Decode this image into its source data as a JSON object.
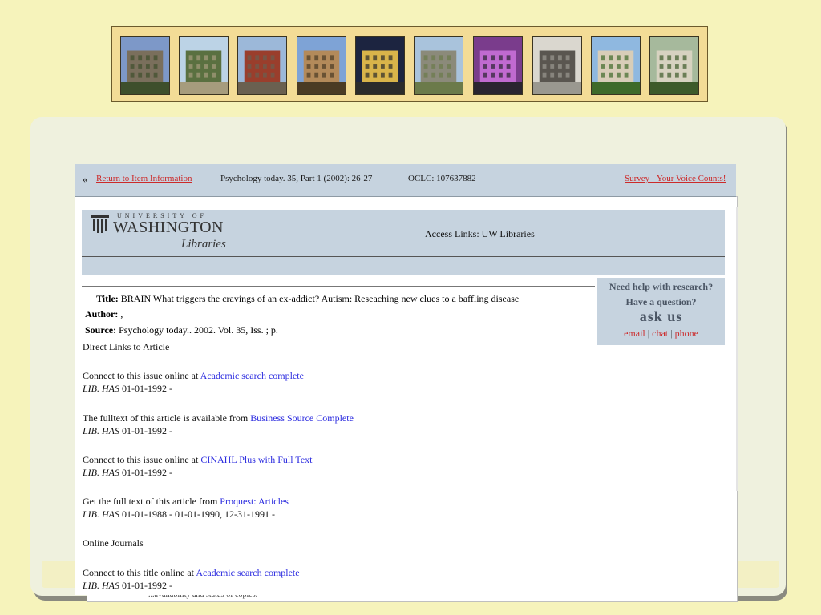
{
  "banner": {
    "thumbs": [
      {
        "name": "campus-photo-1",
        "colors": [
          "#7d98c8",
          "#7a6f5c",
          "#3e4f2c"
        ]
      },
      {
        "name": "campus-photo-2",
        "colors": [
          "#bcd3e6",
          "#5a7040",
          "#a69c7d"
        ]
      },
      {
        "name": "campus-photo-3",
        "colors": [
          "#9cb8d9",
          "#9a3e2c",
          "#6a6050"
        ]
      },
      {
        "name": "campus-photo-4",
        "colors": [
          "#7ea3d6",
          "#b38a5a",
          "#4a3b24"
        ]
      },
      {
        "name": "campus-photo-5",
        "colors": [
          "#1c2440",
          "#d9b44a",
          "#2b2b2b"
        ]
      },
      {
        "name": "campus-photo-6",
        "colors": [
          "#a9c3dc",
          "#8b8a7a",
          "#6b7a4a"
        ]
      },
      {
        "name": "campus-photo-7",
        "colors": [
          "#7a3c8c",
          "#c06ad0",
          "#2a2430"
        ]
      },
      {
        "name": "campus-photo-8",
        "colors": [
          "#dad7cf",
          "#5a5650",
          "#9a9890"
        ]
      },
      {
        "name": "campus-photo-9",
        "colors": [
          "#8fb8e0",
          "#d8cdb8",
          "#3e6a2a"
        ]
      },
      {
        "name": "campus-photo-10",
        "colors": [
          "#a6b99c",
          "#d7d2c0",
          "#3d5a2a"
        ]
      }
    ]
  },
  "topbar": {
    "back_glyph": "«",
    "return_label": "Return to Item Information",
    "citation": "Psychology today. 35, Part 1 (2002): 26-27",
    "oclc": "OCLC: 107637882",
    "survey": "Survey - Your Voice Counts!"
  },
  "header": {
    "university": "UNIVERSITY OF",
    "washington": "WASHINGTON",
    "libraries": "Libraries",
    "title": "Access Links: UW Libraries"
  },
  "record": {
    "title_label": "Title:",
    "title_value": "BRAIN What triggers the cravings of an ex-addict? Autism: Reseaching new clues to a baffling disease",
    "author_label": "Author:",
    "author_value": ",",
    "source_label": "Source:",
    "source_value": "Psychology today.. 2002. Vol. 35, Iss. ; p."
  },
  "help": {
    "line1": "Need help with research?",
    "line2": "Have a question?",
    "line3": "ask us",
    "email": "email",
    "chat": "chat",
    "phone": "phone",
    "sep": "|"
  },
  "links": {
    "direct_heading": "Direct Links to Article",
    "items": [
      {
        "prefix": "Connect to this issue online at",
        "link": "Academic search complete",
        "lib": "LIB. HAS",
        "range": "01-01-1992 -"
      },
      {
        "prefix": "The fulltext of this article is available from",
        "link": "Business Source Complete",
        "lib": "LIB. HAS",
        "range": "01-01-1992 -"
      },
      {
        "prefix": "Connect to this issue online at",
        "link": "CINAHL Plus with Full Text",
        "lib": "LIB. HAS",
        "range": "01-01-1992 -"
      },
      {
        "prefix": "Get the full text of this article from",
        "link": "Proquest: Articles",
        "lib": "LIB. HAS",
        "range": "01-01-1988 - 01-01-1990, 12-31-1991 -"
      }
    ],
    "online_heading": "Online Journals",
    "journal": {
      "prefix": "Connect to this title online at",
      "link": "Academic search complete",
      "lib": "LIB. HAS",
      "range": "01-01-1992 -"
    }
  },
  "bg_doc_text": "...availability and status of copies."
}
